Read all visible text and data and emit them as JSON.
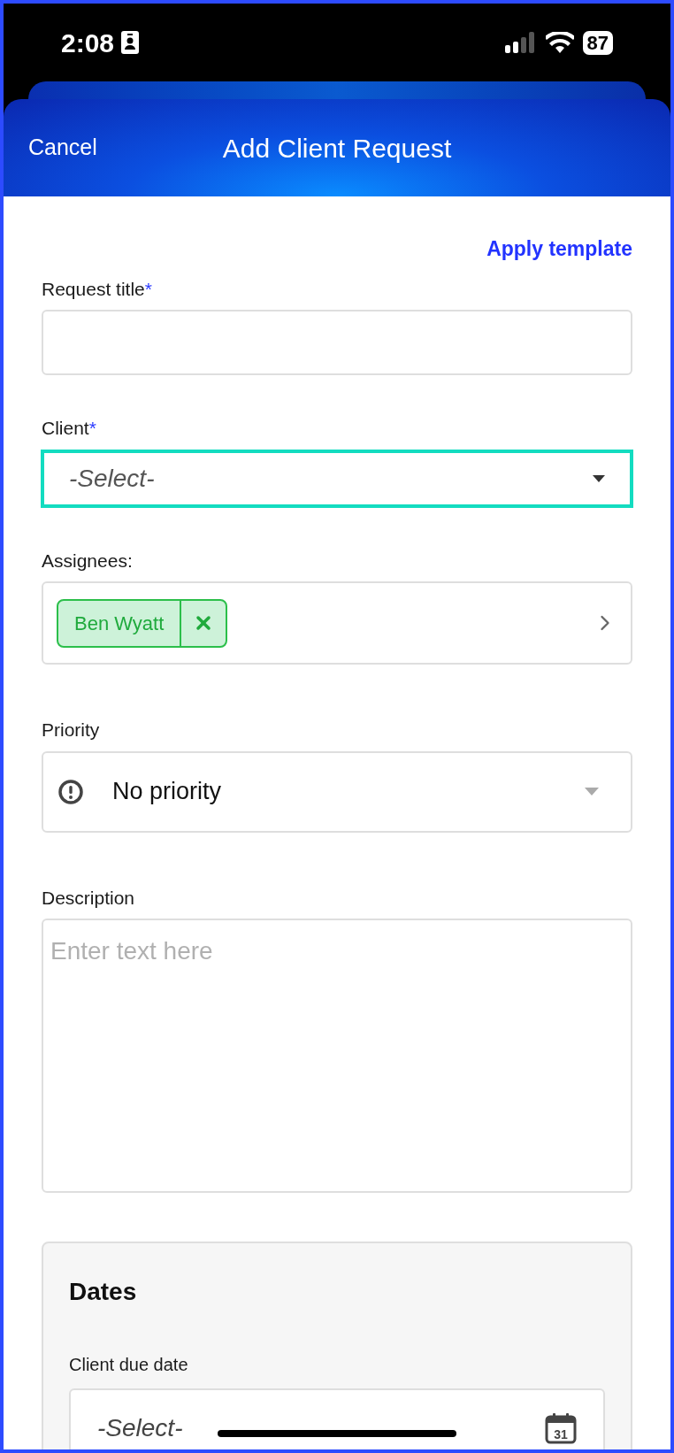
{
  "status_bar": {
    "time": "2:08",
    "battery": "87"
  },
  "header": {
    "cancel": "Cancel",
    "title": "Add Client Request"
  },
  "apply_template": "Apply template",
  "fields": [
    {
      "kind": "text",
      "label": "Request title",
      "required_mark": "*",
      "focused": false
    },
    {
      "kind": "select",
      "label": "Client",
      "required_mark": "*",
      "focused": true,
      "placeholder": "-Select-"
    },
    {
      "kind": "chips",
      "label": "Assignees:",
      "focused": false,
      "chips": [
        {
          "name": "Ben Wyatt"
        }
      ]
    },
    {
      "kind": "priority",
      "label": "Priority",
      "focused": false,
      "value": "No priority"
    },
    {
      "kind": "textarea",
      "label": "Description",
      "focused": false,
      "placeholder": "Enter text here"
    }
  ],
  "dates": {
    "title": "Dates",
    "fields": [
      {
        "label": "Client due date",
        "placeholder": "-Select-",
        "calendar_day": "31"
      }
    ]
  }
}
